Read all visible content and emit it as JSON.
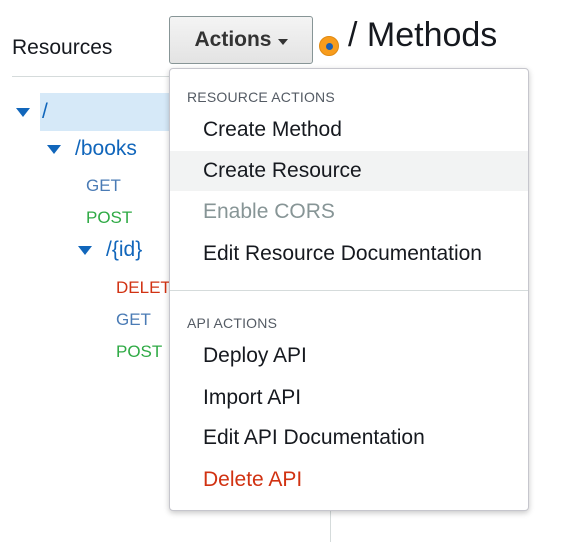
{
  "sidebar": {
    "title": "Resources",
    "tree": {
      "root": "/",
      "books": "/books",
      "books_methods": [
        "GET",
        "POST"
      ],
      "id": "/{id}",
      "id_methods": [
        "DELETE",
        "GET",
        "POST"
      ]
    }
  },
  "toolbar": {
    "actions_label": "Actions",
    "page_title": "/ Methods"
  },
  "dropdown": {
    "resource_header": "RESOURCE ACTIONS",
    "resource_items": [
      "Create Method",
      "Create Resource",
      "Enable CORS",
      "Edit Resource Documentation"
    ],
    "api_header": "API ACTIONS",
    "api_items": [
      "Deploy API",
      "Import API",
      "Edit API Documentation",
      "Delete API"
    ]
  },
  "colors": {
    "link_blue": "#1166bb",
    "get": "#4a7bb5",
    "post": "#2faa45",
    "delete": "#d13212",
    "selected_bg": "#d6e9f8",
    "accent_orange": "#f89c1c"
  },
  "icons": {
    "tree_toggle": "caret-down-icon",
    "actions_caret": "chevron-down-icon",
    "notification": "orange-dot-icon"
  }
}
